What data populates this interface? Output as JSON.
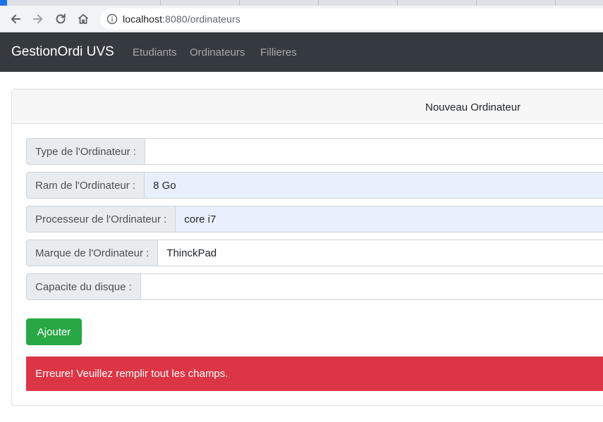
{
  "browser": {
    "url_host": "localhost",
    "url_rest": ":8080/ordinateurs",
    "icons": [
      "back-icon",
      "forward-icon",
      "reload-icon",
      "home-icon",
      "info-icon"
    ]
  },
  "navbar": {
    "brand": "GestionOrdi UVS",
    "links": [
      "Etudiants",
      "Ordinateurs",
      "Fillieres"
    ]
  },
  "card": {
    "title": "Nouveau Ordinateur"
  },
  "form": {
    "fields": [
      {
        "label": "Type de l'Ordinateur :",
        "value": ""
      },
      {
        "label": "Ram de l'Ordinateur :",
        "value": "8 Go"
      },
      {
        "label": "Processeur de l'Ordinateur :",
        "value": "core i7"
      },
      {
        "label": "Marque de l'Ordinateur :",
        "value": "ThinckPad"
      },
      {
        "label": "Capacite du disque :",
        "value": ""
      }
    ],
    "submit_label": "Ajouter"
  },
  "alert": {
    "message": "Erreure! Veuillez remplir tout les champs."
  },
  "colors": {
    "navbar": "#343a40",
    "success": "#28a745",
    "danger": "#dc3545",
    "autofill": "#e8f0fe"
  }
}
